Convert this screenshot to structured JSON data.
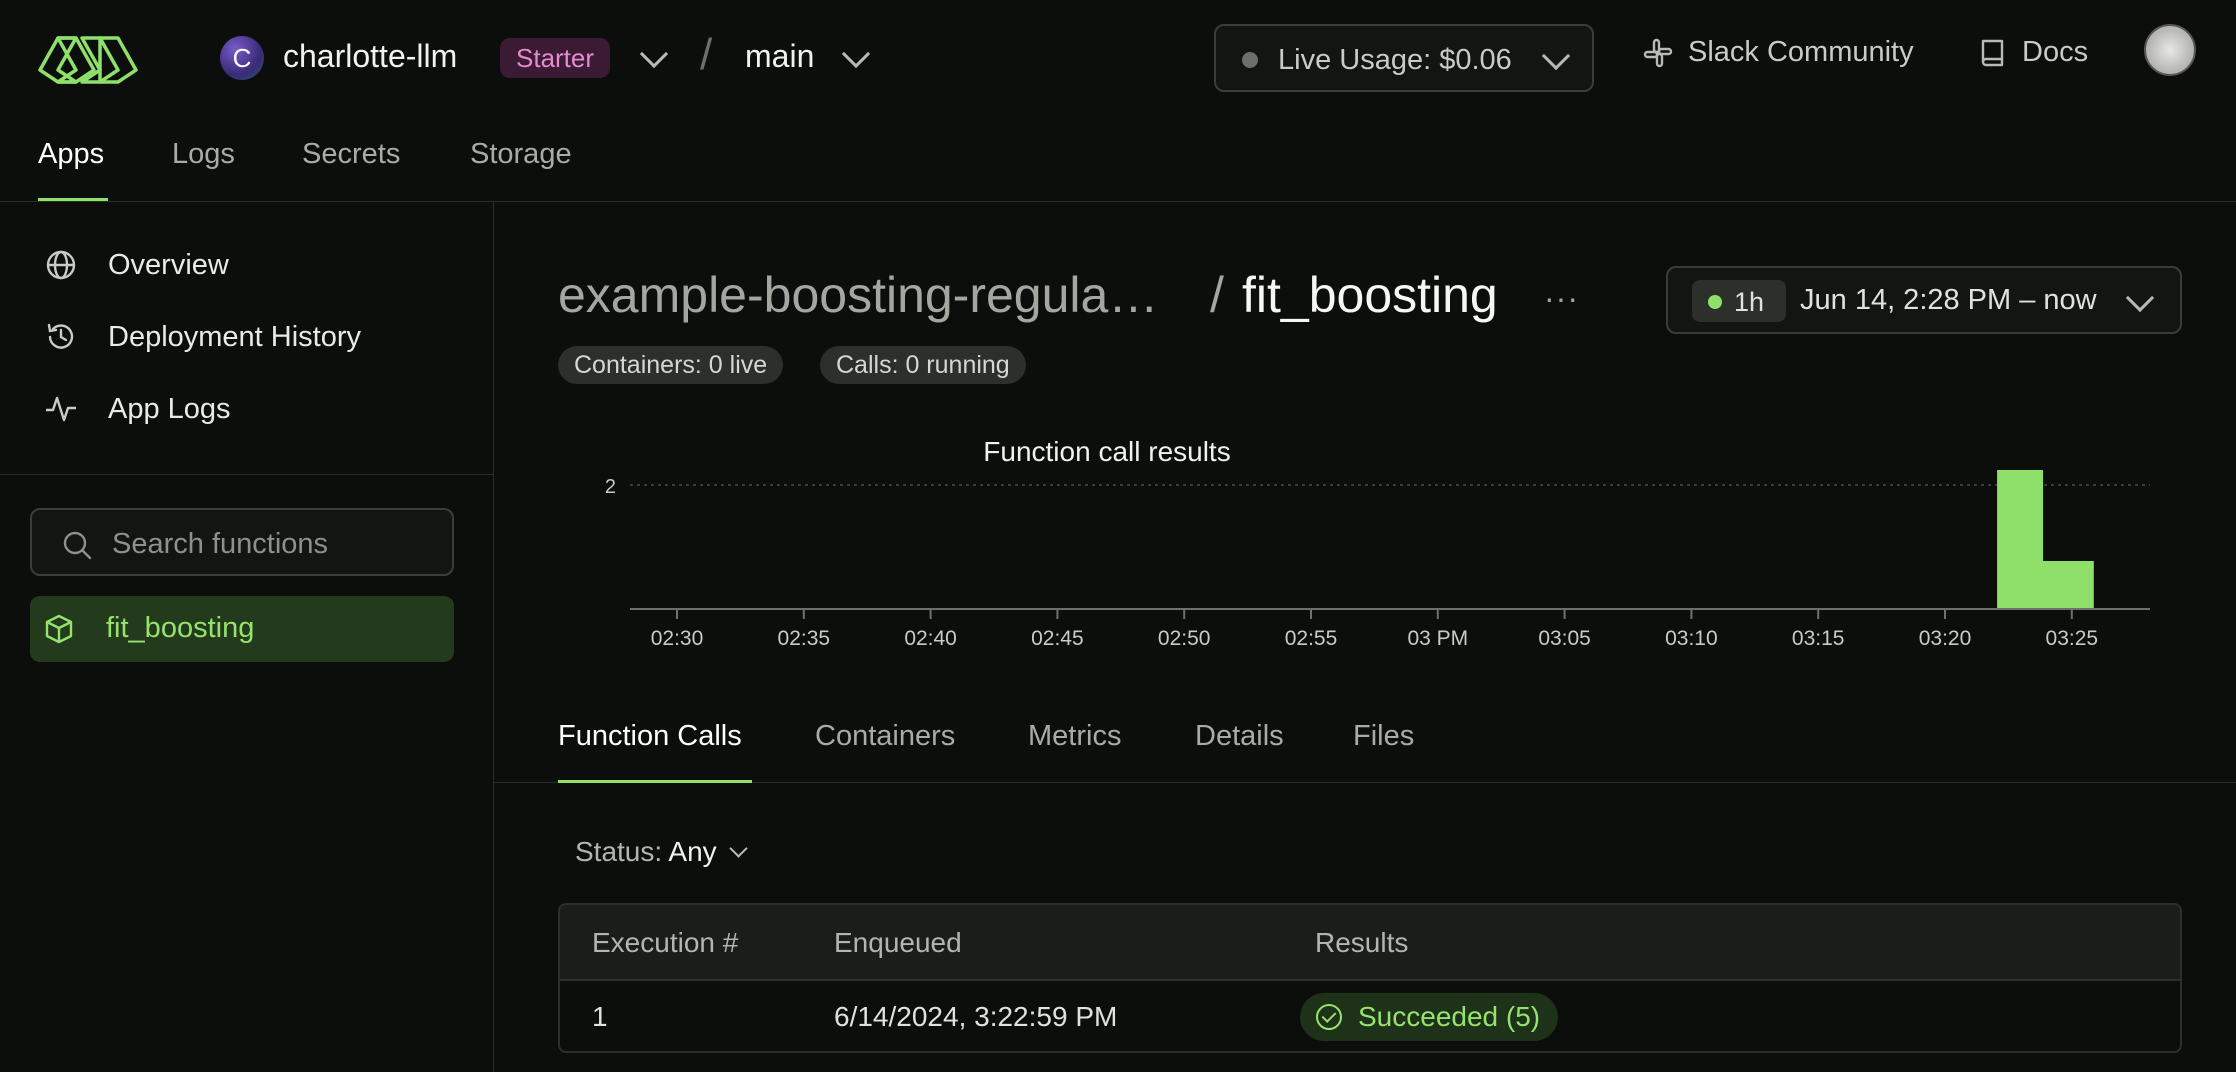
{
  "header": {
    "workspace_initial": "C",
    "workspace_name": "charlotte-llm",
    "plan_badge": "Starter",
    "separator": "/",
    "environment": "main",
    "live_usage": "Live Usage: $0.06",
    "slack_link": "Slack Community",
    "docs_link": "Docs"
  },
  "nav": {
    "tabs": [
      "Apps",
      "Logs",
      "Secrets",
      "Storage"
    ],
    "active": "Apps"
  },
  "sidebar": {
    "items": [
      {
        "label": "Overview",
        "icon": "globe-icon"
      },
      {
        "label": "Deployment History",
        "icon": "history-icon"
      },
      {
        "label": "App Logs",
        "icon": "activity-icon"
      }
    ],
    "search_placeholder": "Search functions",
    "functions": [
      {
        "label": "fit_boosting",
        "icon": "cube-icon"
      }
    ]
  },
  "main": {
    "app_name": "example-boosting-regula…",
    "title_sep": "/",
    "function_name": "fit_boosting",
    "more": "···",
    "containers_pill": "Containers: 0 live",
    "calls_pill": "Calls: 0 running",
    "range_chip": "1h",
    "range_text": "Jun 14, 2:28 PM – now",
    "tabs": [
      "Function Calls",
      "Containers",
      "Metrics",
      "Details",
      "Files"
    ],
    "active_tab": "Function Calls",
    "status_label": "Status:",
    "status_value": "Any",
    "table": {
      "columns": [
        "Execution #",
        "Enqueued",
        "Results"
      ],
      "rows": [
        {
          "execution": "1",
          "enqueued": "6/14/2024, 3:22:59 PM",
          "result": "Succeeded (5)"
        }
      ]
    }
  },
  "colors": {
    "accent": "#8ee06a",
    "background": "#0b0e0a",
    "starter_badge_bg": "#3b1a34",
    "starter_badge_text": "#e58ad0"
  },
  "chart_data": {
    "type": "bar",
    "title": "Function call results",
    "categories": [
      "02:30",
      "02:35",
      "02:40",
      "02:45",
      "02:50",
      "02:55",
      "03 PM",
      "03:05",
      "03:10",
      "03:15",
      "03:20",
      "03:25"
    ],
    "bars": [
      {
        "time": "03:23",
        "value": 2.4
      },
      {
        "time": "03:24",
        "value": 0.8
      },
      {
        "time": "03:25",
        "value": 0.8
      }
    ],
    "yticks": [
      2
    ],
    "ylim": [
      0,
      2.5
    ],
    "grid": "dashed-at-ticks",
    "color": "#8ee06a"
  }
}
